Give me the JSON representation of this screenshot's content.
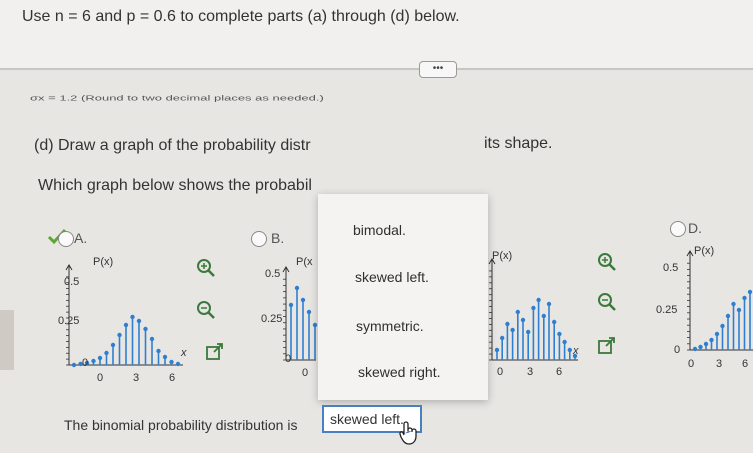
{
  "question": {
    "text": "Use n = 6 and p = 0.6 to complete parts (a) through (d) below."
  },
  "toolbar": {
    "more_label": "•••"
  },
  "part_c": {
    "text": "σx = 1.2 (Round to two decimal places as needed.)"
  },
  "part_d": {
    "prompt_left": "(d) Draw a graph of the probability distr",
    "prompt_right": "its shape.",
    "which_text": "Which graph below shows the probabil"
  },
  "options": [
    {
      "label": "A.",
      "selected": true,
      "ylabel": "P(x)",
      "yticks": [
        "0.5",
        "0.25",
        "0"
      ],
      "xticks": [
        "0",
        "3",
        "6"
      ]
    },
    {
      "label": "B.",
      "selected": false,
      "ylabel": "P(x",
      "yticks": [
        "0.5",
        "0.25",
        "0"
      ],
      "xticks": [
        "0"
      ]
    },
    {
      "label": "",
      "selected": false,
      "ylabel": "P(x)",
      "yticks": [],
      "xticks": [
        "0",
        "3",
        "6"
      ]
    },
    {
      "label": "D.",
      "selected": false,
      "ylabel": "P(x)",
      "yticks": [
        "0.5",
        "0.25",
        "0"
      ],
      "xticks": [
        "0",
        "3",
        "6"
      ]
    }
  ],
  "x_axis_label": "x",
  "dropdown": {
    "items": [
      "bimodal.",
      "skewed left.",
      "symmetric.",
      "skewed right."
    ]
  },
  "answer": {
    "prefix": "The binomial probability distribution is",
    "selected": "skewed left."
  },
  "colors": {
    "stem": "#2f7fd0",
    "check": "#5aa832",
    "highlight": "#4a7fc1"
  }
}
